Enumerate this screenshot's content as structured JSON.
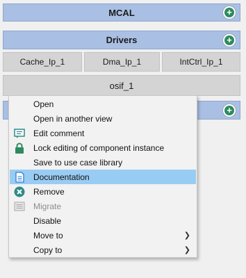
{
  "mcal": {
    "title": "MCAL"
  },
  "drivers": {
    "title": "Drivers",
    "components": [
      "Cache_Ip_1",
      "Dma_Ip_1",
      "IntCtrl_Ip_1"
    ],
    "osif": "osif_1"
  },
  "context_menu": {
    "items": [
      {
        "label": "Open",
        "icon": "",
        "enabled": true
      },
      {
        "label": "Open in another view",
        "icon": "",
        "enabled": true
      },
      {
        "label": "Edit comment",
        "icon": "comment-icon",
        "enabled": true
      },
      {
        "label": "Lock editing of component instance",
        "icon": "lock-icon",
        "enabled": true
      },
      {
        "label": "Save to use case library",
        "icon": "",
        "enabled": true
      },
      {
        "label": "Documentation",
        "icon": "document-icon",
        "enabled": true,
        "highlighted": true
      },
      {
        "label": "Remove",
        "icon": "remove-icon",
        "enabled": true
      },
      {
        "label": "Migrate",
        "icon": "migrate-icon",
        "enabled": false
      },
      {
        "label": "Disable",
        "icon": "",
        "enabled": true
      },
      {
        "label": "Move to",
        "icon": "",
        "enabled": true,
        "submenu": true
      },
      {
        "label": "Copy to",
        "icon": "",
        "enabled": true,
        "submenu": true
      }
    ]
  },
  "colors": {
    "bar": "#a9bfe3",
    "add_button": "#2e8a5f",
    "highlight": "#99ccf3"
  }
}
